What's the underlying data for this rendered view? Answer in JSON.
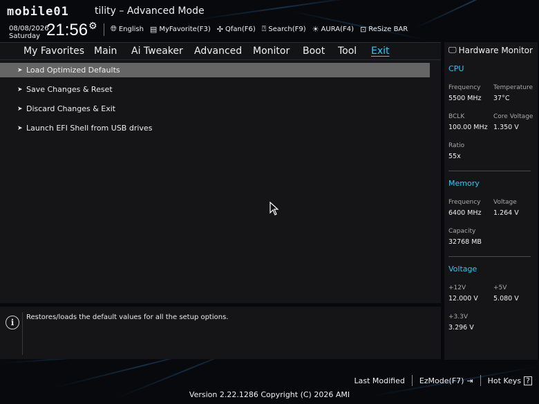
{
  "header": {
    "logo_text": "mobile01",
    "title": "tility – Advanced Mode",
    "date": "08/08/2026",
    "weekday": "Saturday",
    "time": "21:56",
    "toolbar": [
      {
        "icon": "globe-icon",
        "label": "English"
      },
      {
        "icon": "favorite-icon",
        "label": "MyFavorite(F3)"
      },
      {
        "icon": "fan-icon",
        "label": "Qfan(F6)"
      },
      {
        "icon": "search-icon",
        "label": "Search(F9)"
      },
      {
        "icon": "aura-icon",
        "label": "AURA(F4)"
      },
      {
        "icon": "resize-bar-icon",
        "label": "ReSize BAR"
      }
    ]
  },
  "tabs": [
    "My Favorites",
    "Main",
    "Ai Tweaker",
    "Advanced",
    "Monitor",
    "Boot",
    "Tool",
    "Exit"
  ],
  "active_tab": "Exit",
  "menu": [
    {
      "label": "Load Optimized Defaults",
      "selected": true
    },
    {
      "label": "Save Changes & Reset",
      "selected": false
    },
    {
      "label": "Discard Changes & Exit",
      "selected": false
    },
    {
      "label": "Launch EFI Shell from USB drives",
      "selected": false
    }
  ],
  "info": {
    "text": "Restores/loads the default values for all the setup options."
  },
  "hardware_monitor": {
    "title": "Hardware Monitor",
    "cpu": {
      "section": "CPU",
      "frequency_label": "Frequency",
      "frequency_value": "5500 MHz",
      "temperature_label": "Temperature",
      "temperature_value": "37°C",
      "bclk_label": "BCLK",
      "bclk_value": "100.00 MHz",
      "core_voltage_label": "Core Voltage",
      "core_voltage_value": "1.350 V",
      "ratio_label": "Ratio",
      "ratio_value": "55x"
    },
    "memory": {
      "section": "Memory",
      "frequency_label": "Frequency",
      "frequency_value": "6400 MHz",
      "voltage_label": "Voltage",
      "voltage_value": "1.264 V",
      "capacity_label": "Capacity",
      "capacity_value": "32768 MB"
    },
    "voltage": {
      "section": "Voltage",
      "v12_label": "+12V",
      "v12_value": "12.000 V",
      "v5_label": "+5V",
      "v5_value": "5.080 V",
      "v33_label": "+3.3V",
      "v33_value": "3.296 V"
    }
  },
  "footer": {
    "last_modified": "Last Modified",
    "ezmode": "EzMode(F7)",
    "hotkeys": "Hot Keys",
    "hotkeys_icon": "?",
    "version": "Version 2.22.1286 Copyright (C) 2026 AMI"
  },
  "colors": {
    "accent": "#3ec3ef",
    "selected_row": "#656565",
    "panel": "#151517"
  }
}
